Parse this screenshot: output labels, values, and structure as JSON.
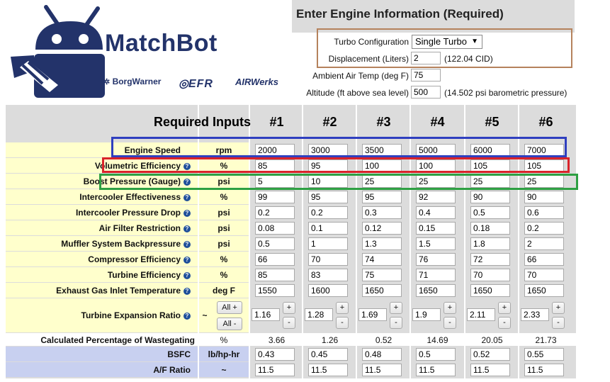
{
  "brand": {
    "name": "MatchBot",
    "partners": [
      "BorgWarner",
      "EFR",
      "AIRWerks"
    ]
  },
  "engine": {
    "title": "Enter Engine Information (Required)",
    "turbo_config": {
      "label": "Turbo Configuration",
      "value": "Single Turbo"
    },
    "displacement": {
      "label": "Displacement (Liters)",
      "value": "2",
      "note": "(122.04 CID)"
    },
    "ambient_temp": {
      "label": "Ambient Air Temp (deg F)",
      "value": "75"
    },
    "altitude": {
      "label": "Altitude (ft above sea level)",
      "value": "500",
      "note": "(14.502 psi barometric pressure)"
    }
  },
  "grid": {
    "title": "Required Inputs",
    "columns": [
      "#1",
      "#2",
      "#3",
      "#4",
      "#5",
      "#6"
    ],
    "rows": [
      {
        "label": "Engine Speed",
        "unit": "rpm",
        "values": [
          "2000",
          "3000",
          "3500",
          "5000",
          "6000",
          "7000"
        ]
      },
      {
        "label": "Volumetric Efficiency",
        "unit": "%",
        "values": [
          "85",
          "95",
          "100",
          "100",
          "105",
          "105"
        ]
      },
      {
        "label": "Boost Pressure (Gauge)",
        "unit": "psi",
        "values": [
          "5",
          "10",
          "25",
          "25",
          "25",
          "25"
        ]
      },
      {
        "label": "Intercooler Effectiveness",
        "unit": "%",
        "values": [
          "99",
          "95",
          "95",
          "92",
          "90",
          "90"
        ]
      },
      {
        "label": "Intercooler Pressure Drop",
        "unit": "psi",
        "values": [
          "0.2",
          "0.2",
          "0.3",
          "0.4",
          "0.5",
          "0.6"
        ]
      },
      {
        "label": "Air Filter Restriction",
        "unit": "psi",
        "values": [
          "0.08",
          "0.1",
          "0.12",
          "0.15",
          "0.18",
          "0.2"
        ]
      },
      {
        "label": "Muffler System Backpressure",
        "unit": "psi",
        "values": [
          "0.5",
          "1",
          "1.3",
          "1.5",
          "1.8",
          "2"
        ]
      },
      {
        "label": "Compressor Efficiency",
        "unit": "%",
        "values": [
          "66",
          "70",
          "74",
          "76",
          "72",
          "66"
        ]
      },
      {
        "label": "Turbine Efficiency",
        "unit": "%",
        "values": [
          "85",
          "83",
          "75",
          "71",
          "70",
          "70"
        ]
      },
      {
        "label": "Exhaust Gas Inlet Temperature",
        "unit": "deg F",
        "values": [
          "1550",
          "1600",
          "1650",
          "1650",
          "1650",
          "1650"
        ]
      }
    ],
    "expansion": {
      "label": "Turbine Expansion Ratio",
      "unit": "~",
      "all_plus": "All +",
      "all_minus": "All -",
      "plus": "+",
      "minus": "-",
      "values": [
        "1.16",
        "1.28",
        "1.69",
        "1.9",
        "2.11",
        "2.33"
      ]
    },
    "wastegate": {
      "label": "Calculated Percentage of Wastegating",
      "unit": "%",
      "values": [
        "3.66",
        "1.26",
        "0.52",
        "14.69",
        "20.05",
        "21.73"
      ]
    },
    "bsfc": {
      "label": "BSFC",
      "unit": "lb/hp-hr",
      "values": [
        "0.43",
        "0.45",
        "0.48",
        "0.5",
        "0.52",
        "0.55"
      ]
    },
    "af": {
      "label": "A/F Ratio",
      "unit": "~",
      "values": [
        "11.5",
        "11.5",
        "11.5",
        "11.5",
        "11.5",
        "11.5"
      ]
    },
    "help_glyph": "?"
  },
  "colors": {
    "yellow": "#ffffcc",
    "blue_row": "#c8d0f0",
    "gray": "#dcdcdc",
    "navy": "#23336a",
    "highlight_brown": "#b5825c",
    "highlight_blue": "#2f3fbf",
    "highlight_red": "#d9232a",
    "highlight_green": "#2ea043"
  }
}
